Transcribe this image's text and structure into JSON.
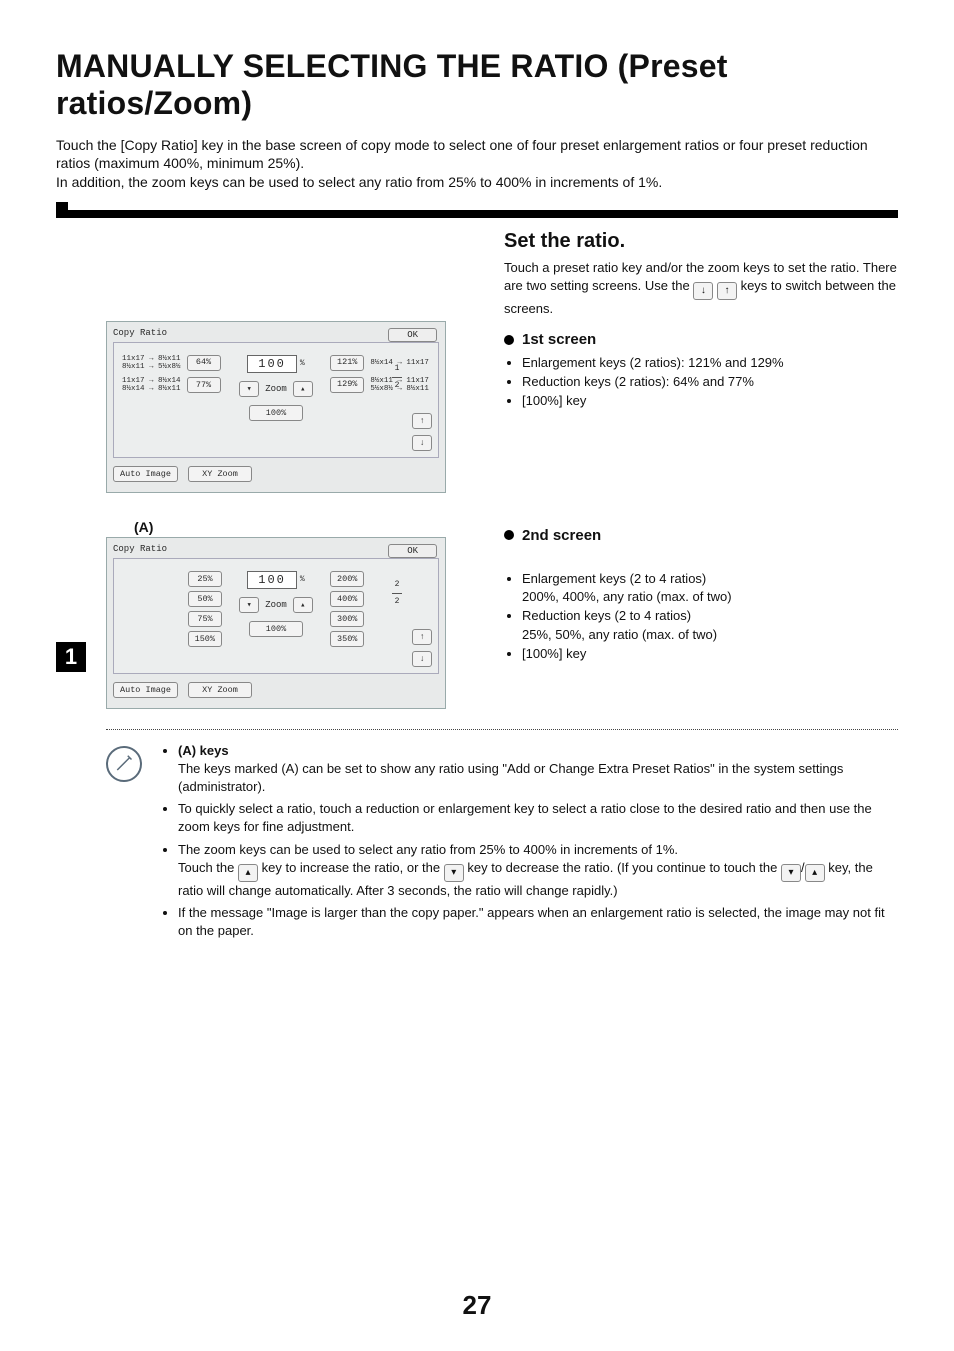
{
  "title": "MANUALLY SELECTING THE RATIO (Preset ratios/Zoom)",
  "intro_line1": "Touch the [Copy Ratio] key in the base screen of copy mode to select one of four preset enlargement ratios or four preset reduction ratios (maximum 400%, minimum 25%).",
  "intro_line2": "In addition, the zoom keys can be used to select any ratio from 25% to 400% in increments of 1%.",
  "step_number": "1",
  "set_ratio_heading": "Set the ratio.",
  "set_ratio_text_a": "Touch a preset ratio key and/or the zoom keys to set the ratio. There are two setting screens. Use the ",
  "set_ratio_text_b": " keys to switch between the screens.",
  "screen1_heading": "1st screen",
  "screen1_bullets": [
    "Enlargement keys (2 ratios): 121% and 129%",
    "Reduction keys (2 ratios): 64% and 77%",
    "[100%] key"
  ],
  "screen2_heading": "2nd screen",
  "screen2_bullets": [
    "Enlargement keys (2 to 4 ratios)",
    "Reduction keys (2 to 4 ratios)",
    "[100%] key"
  ],
  "screen2_sub1": "200%, 400%, any ratio (max. of two)",
  "screen2_sub2": "25%, 50%, any ratio (max. of two)",
  "panel1": {
    "title": "Copy Ratio",
    "ok": "OK",
    "ratio": "100",
    "pct": "%",
    "zoom_label": "Zoom",
    "hundred": "100%",
    "auto_image": "Auto Image",
    "xy_zoom": "XY Zoom",
    "left": [
      {
        "line1": "11x17 → 8½x11",
        "line2": "8½x11 → 5½x8½",
        "btn": "64%"
      },
      {
        "line1": "11x17 → 8½x14",
        "line2": "8½x14 → 8½x11",
        "btn": "77%"
      }
    ],
    "right": [
      {
        "btn": "121%",
        "line1": "8½x14 → 11x17"
      },
      {
        "btn": "129%",
        "line1": "8½x11 → 11x17",
        "line2": "5½x8½ → 8½x11"
      }
    ],
    "page_top": "1",
    "page_bot": "2"
  },
  "panel2_label": "(A)",
  "panel2": {
    "title": "Copy Ratio",
    "ok": "OK",
    "ratio": "100",
    "pct": "%",
    "zoom_label": "Zoom",
    "hundred": "100%",
    "auto_image": "Auto Image",
    "xy_zoom": "XY Zoom",
    "left_keys": [
      "25%",
      "50%",
      "75%",
      "150%"
    ],
    "right_keys": [
      "200%",
      "400%",
      "300%",
      "350%"
    ],
    "page_top": "2",
    "page_bot": "2"
  },
  "notes_heading": "(A) keys",
  "note1": "The keys marked (A) can be set to show any ratio using \"Add or Change Extra Preset Ratios\" in the system settings (administrator).",
  "note2": "To quickly select a ratio, touch a reduction or enlargement key to select a ratio close to the desired ratio and then use the zoom keys for fine adjustment.",
  "note3a": "The zoom keys can be used to select any ratio from 25% to 400% in increments of 1%.",
  "note3b_a": "Touch the ",
  "note3b_b": " key to increase the ratio, or the ",
  "note3b_c": " key to decrease the ratio. (If you continue to touch the ",
  "note3b_d": " key, the ratio will change automatically. After 3 seconds, the ratio will change rapidly.)",
  "note4": "If the message \"Image is larger than the copy paper.\" appears when an enlargement ratio is selected, the image may not fit on the paper.",
  "page_number": "27"
}
